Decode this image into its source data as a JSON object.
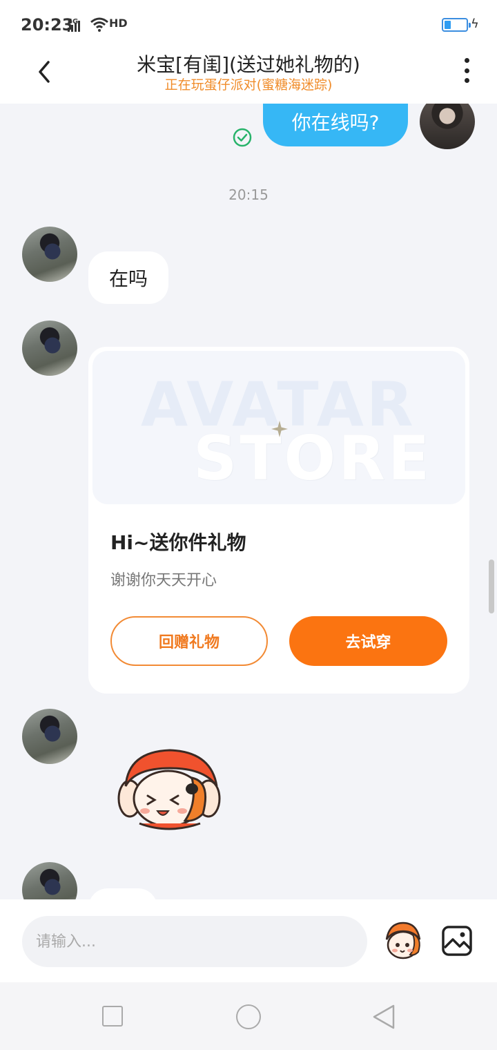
{
  "status_bar": {
    "time": "20:23",
    "network": "4G",
    "hd_label": "HD",
    "battery_level": 0.3
  },
  "header": {
    "title": "米宝[有闺](送过她礼物的)",
    "subtitle": "正在玩蛋仔派对(蜜糖海迷踪)"
  },
  "messages": {
    "me_text": "你在线吗?",
    "time_separator": "20:15",
    "peer_text": "在吗"
  },
  "gift_card": {
    "banner_text_1": "AVATAR",
    "banner_text_2": "STORE",
    "title": "Hi~送你件礼物",
    "subtitle": "谢谢你天天开心",
    "return_gift_label": "回赠礼物",
    "try_on_label": "去试穿"
  },
  "input": {
    "placeholder": "请输入..."
  },
  "colors": {
    "accent_orange": "#fb7411",
    "my_bubble": "#36b7f5",
    "subtitle_orange": "#f08c2a"
  }
}
